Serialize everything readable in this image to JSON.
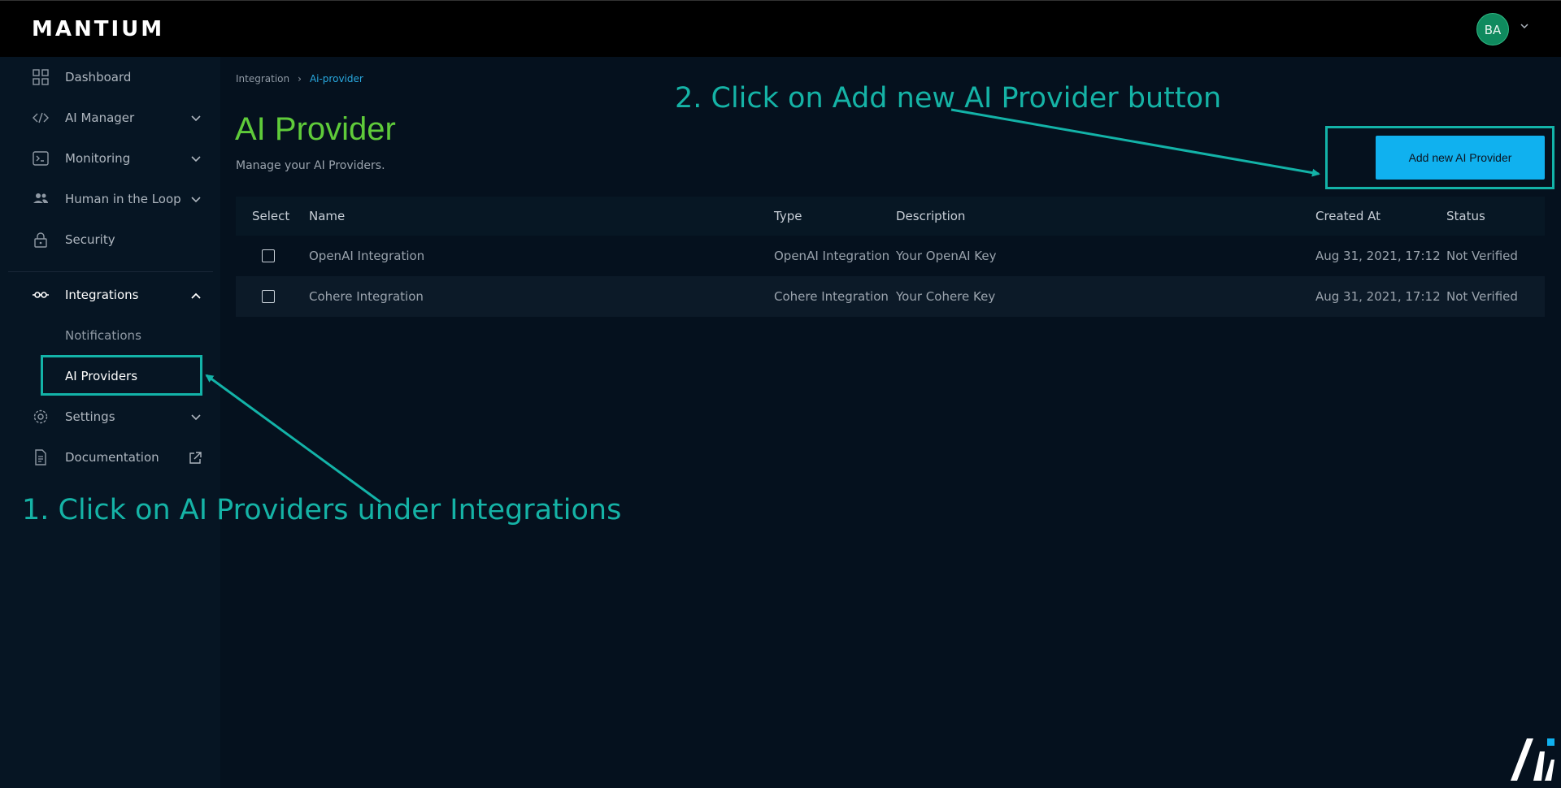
{
  "header": {
    "logo_text": "MANTIUM",
    "user_initials": "BA"
  },
  "sidebar": {
    "items": [
      {
        "label": "Dashboard",
        "icon": "grid-icon"
      },
      {
        "label": "AI Manager",
        "icon": "code-icon"
      },
      {
        "label": "Monitoring",
        "icon": "terminal-icon"
      },
      {
        "label": "Human in the Loop",
        "icon": "people-icon"
      },
      {
        "label": "Security",
        "icon": "lock-icon"
      },
      {
        "label": "Integrations",
        "icon": "integration-icon"
      },
      {
        "label": "Settings",
        "icon": "gear-icon"
      },
      {
        "label": "Documentation",
        "icon": "document-icon"
      }
    ],
    "integrations_sub": [
      {
        "label": "Notifications"
      },
      {
        "label": "AI Providers"
      }
    ]
  },
  "breadcrumb": {
    "parent": "Integration",
    "separator": "›",
    "current": "Ai-provider"
  },
  "page": {
    "title": "AI Provider",
    "subtitle": "Manage your AI Providers.",
    "add_button": "Add new AI Provider"
  },
  "table": {
    "columns": [
      "Select",
      "Name",
      "Type",
      "Description",
      "Created At",
      "Status"
    ],
    "rows": [
      {
        "name": "OpenAI Integration",
        "type": "OpenAI Integration",
        "description": "Your OpenAI Key",
        "created_at": "Aug 31, 2021, 17:12",
        "status": "Not Verified"
      },
      {
        "name": "Cohere Integration",
        "type": "Cohere Integration",
        "description": "Your Cohere Key",
        "created_at": "Aug 31, 2021, 17:12",
        "status": "Not Verified"
      }
    ]
  },
  "annotations": {
    "step1": "1. Click on AI Providers under Integrations",
    "step2": "2. Click on Add new AI Provider button",
    "color": "#15b3a6"
  },
  "colors": {
    "title_green": "#5fcb3a",
    "accent_blue": "#10b1ef",
    "background": "#05111e"
  }
}
